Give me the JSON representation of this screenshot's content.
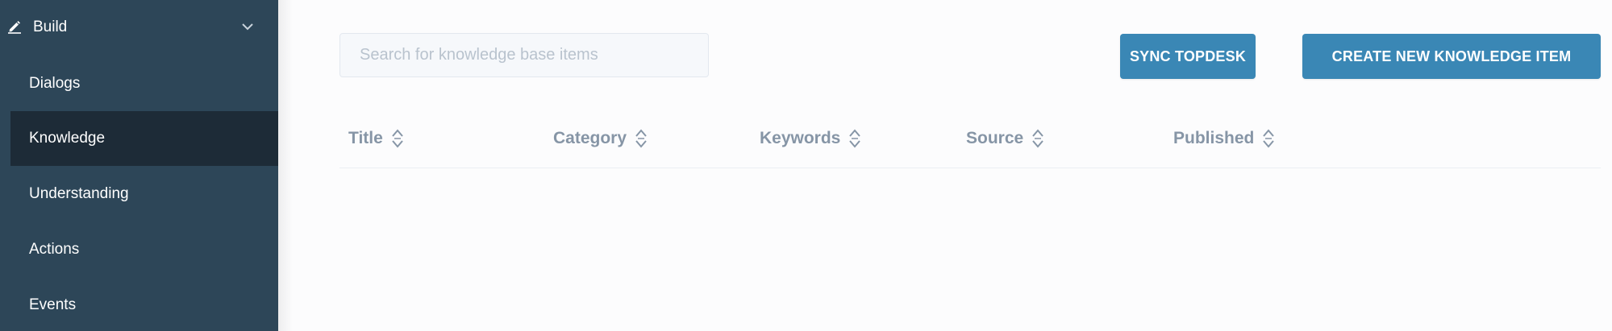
{
  "sidebar": {
    "section": {
      "label": "Build",
      "icon": "pencil-icon",
      "toggle_icon": "chevron-down-icon"
    },
    "items": [
      {
        "label": "Dialogs",
        "active": false
      },
      {
        "label": "Knowledge",
        "active": true
      },
      {
        "label": "Understanding",
        "active": false
      },
      {
        "label": "Actions",
        "active": false
      },
      {
        "label": "Events",
        "active": false
      }
    ]
  },
  "main": {
    "search": {
      "placeholder": "Search for knowledge base items",
      "value": ""
    },
    "buttons": {
      "sync_label": "SYNC TOPDESK",
      "create_label": "CREATE NEW KNOWLEDGE ITEM"
    },
    "table": {
      "columns": [
        {
          "label": "Title",
          "icon": "sort-icon"
        },
        {
          "label": "Category",
          "icon": "sort-icon"
        },
        {
          "label": "Keywords",
          "icon": "sort-icon"
        },
        {
          "label": "Source",
          "icon": "sort-icon"
        },
        {
          "label": "Published",
          "icon": "sort-icon"
        }
      ],
      "rows": []
    }
  },
  "colors": {
    "sidebar_bg": "#2d4658",
    "sidebar_active_bg": "#1d2b37",
    "accent": "#3a87b5",
    "header_text": "#8695a6",
    "page_bg": "#fcfcfd"
  }
}
